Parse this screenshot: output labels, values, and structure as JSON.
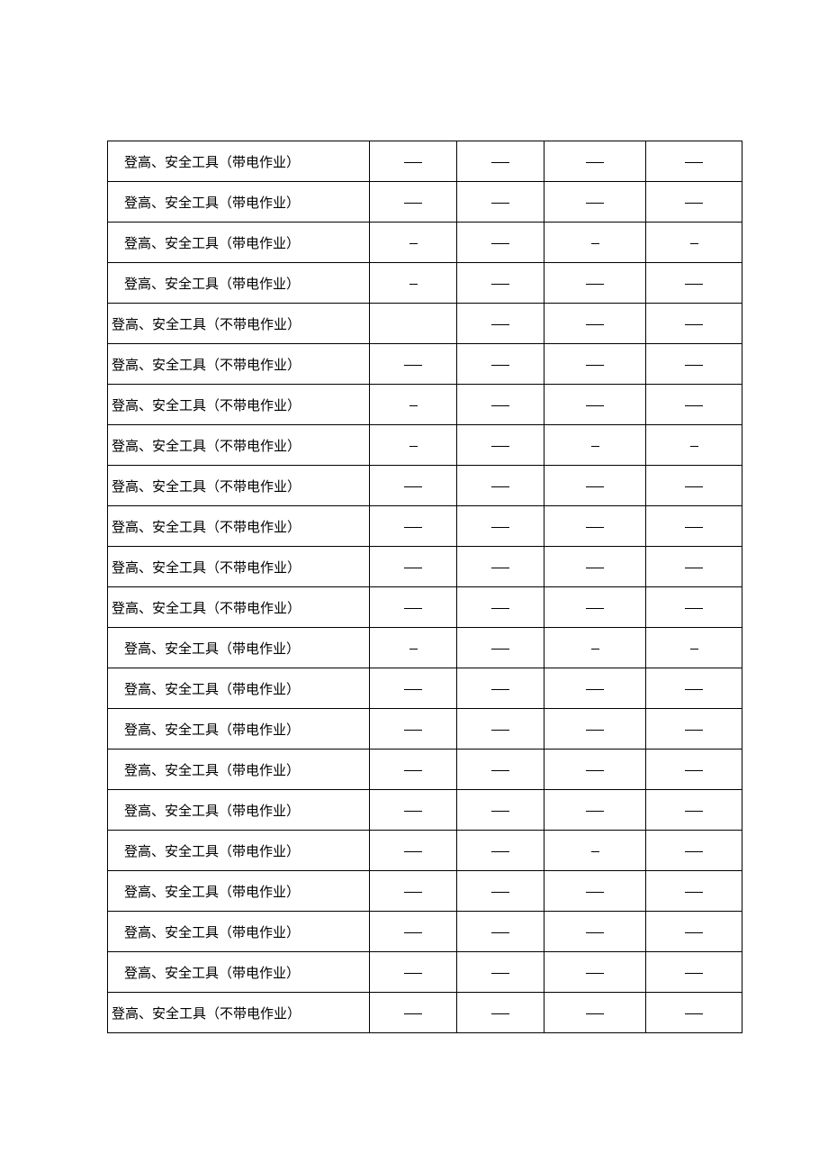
{
  "labels": {
    "live": "登高、安全工具（带电作业）",
    "nonlive": "登高、安全工具（不带电作业）"
  },
  "rows": [
    {
      "type": "live",
      "c1": "one",
      "c2": "one",
      "c3": "one",
      "c4": "one"
    },
    {
      "type": "live",
      "c1": "one",
      "c2": "one",
      "c3": "one",
      "c4": "one"
    },
    {
      "type": "live",
      "c1": "dash",
      "c2": "one",
      "c3": "dash",
      "c4": "dash"
    },
    {
      "type": "live",
      "c1": "dash",
      "c2": "one",
      "c3": "one",
      "c4": "one"
    },
    {
      "type": "nonlive",
      "c1": "",
      "c2": "one",
      "c3": "one",
      "c4": "one"
    },
    {
      "type": "nonlive",
      "c1": "one",
      "c2": "one",
      "c3": "one",
      "c4": "one"
    },
    {
      "type": "nonlive",
      "c1": "dash",
      "c2": "one",
      "c3": "one",
      "c4": "one"
    },
    {
      "type": "nonlive",
      "c1": "dash",
      "c2": "one",
      "c3": "dash",
      "c4": "dash"
    },
    {
      "type": "nonlive",
      "c1": "one",
      "c2": "one",
      "c3": "one",
      "c4": "one"
    },
    {
      "type": "nonlive",
      "c1": "one",
      "c2": "one",
      "c3": "one",
      "c4": "one"
    },
    {
      "type": "nonlive",
      "c1": "one",
      "c2": "one",
      "c3": "one",
      "c4": "one"
    },
    {
      "type": "nonlive",
      "c1": "one",
      "c2": "one",
      "c3": "one",
      "c4": "one"
    },
    {
      "type": "live",
      "c1": "dash",
      "c2": "one",
      "c3": "dash",
      "c4": "dash"
    },
    {
      "type": "live",
      "c1": "one",
      "c2": "one",
      "c3": "one",
      "c4": "one"
    },
    {
      "type": "live",
      "c1": "one",
      "c2": "one",
      "c3": "one",
      "c4": "one"
    },
    {
      "type": "live",
      "c1": "one",
      "c2": "one",
      "c3": "one",
      "c4": "one"
    },
    {
      "type": "live",
      "c1": "one",
      "c2": "one",
      "c3": "one",
      "c4": "one"
    },
    {
      "type": "live",
      "c1": "one",
      "c2": "one",
      "c3": "dash",
      "c4": "one"
    },
    {
      "type": "live",
      "c1": "one",
      "c2": "one",
      "c3": "one",
      "c4": "one"
    },
    {
      "type": "live",
      "c1": "one",
      "c2": "one",
      "c3": "one",
      "c4": "one"
    },
    {
      "type": "live",
      "c1": "one",
      "c2": "one",
      "c3": "one",
      "c4": "one"
    },
    {
      "type": "nonlive",
      "c1": "one",
      "c2": "one",
      "c3": "one",
      "c4": "one"
    }
  ]
}
